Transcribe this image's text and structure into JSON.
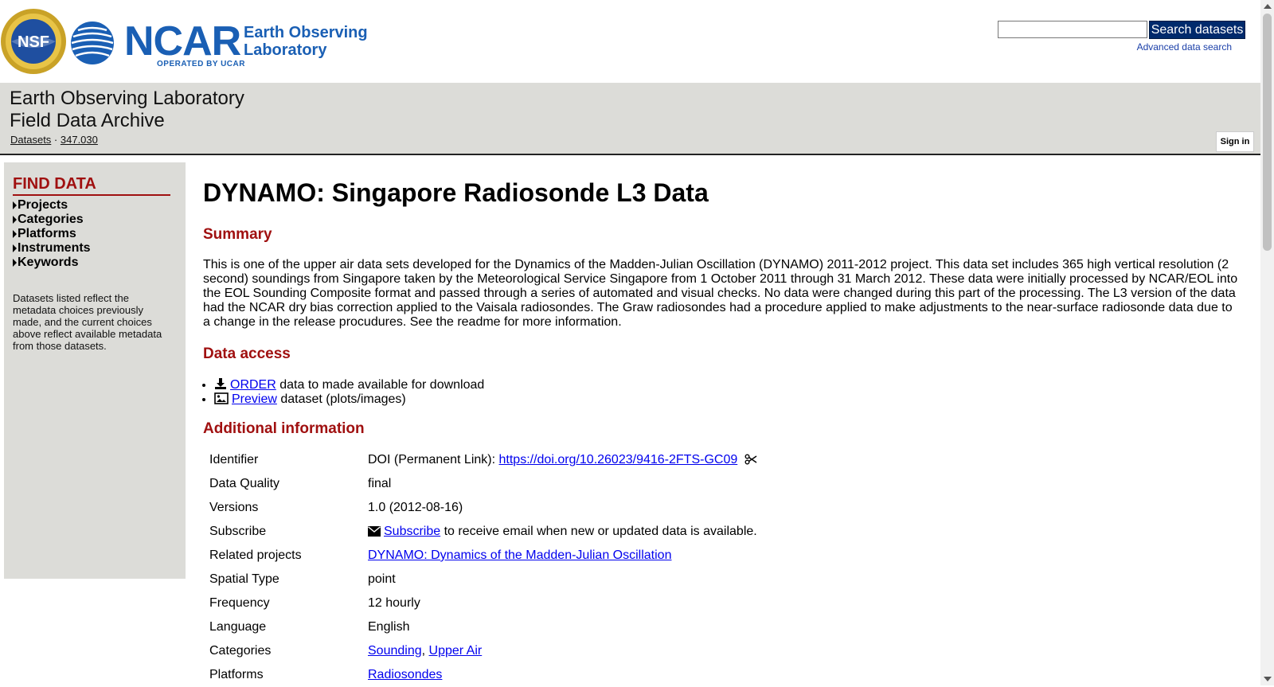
{
  "header": {
    "nsf_logo_text": "NSF",
    "ncar_word": "NCAR",
    "ncar_operated": "OPERATED BY UCAR",
    "eol_line1": "Earth Observing",
    "eol_line2": "Laboratory",
    "search_button": "Search datasets",
    "search_value": "",
    "advanced_search": "Advanced data search"
  },
  "band": {
    "title_line1": "Earth Observing Laboratory",
    "title_line2": "Field Data Archive",
    "breadcrumb_datasets": "Datasets",
    "breadcrumb_sep": " · ",
    "breadcrumb_id": "347.030",
    "signin": "Sign in"
  },
  "sidebar": {
    "title": "FIND DATA",
    "facets": [
      "Projects",
      "Categories",
      "Platforms",
      "Instruments",
      "Keywords"
    ],
    "note": "Datasets listed reflect the metadata choices previously made, and the current choices above reflect available metadata from those datasets."
  },
  "main": {
    "title": "DYNAMO: Singapore Radiosonde L3 Data",
    "summary_heading": "Summary",
    "summary": "This is one of the upper air data sets developed for the Dynamics of the Madden-Julian Oscillation (DYNAMO) 2011-2012 project. This data set includes 365 high vertical resolution (2 second) soundings from Singapore taken by the Meteorological Service Singapore from 1 October 2011 through 31 March 2012. These data were initially processed by NCAR/EOL into the EOL Sounding Composite format and passed through a series of automated and visual checks. No data were changed during this part of the processing. The L3 version of the data had the NCAR dry bias correction applied to the Vaisala radiosondes. The Graw radiosondes had a procedure applied to make adjustments to the near-surface radiosonde data due to a change in the release procudures. See the readme for more information.",
    "access_heading": "Data access",
    "access": {
      "order_link": "ORDER",
      "order_text": " data to made available for download",
      "preview_link": "Preview",
      "preview_text": " dataset (plots/images)"
    },
    "additional_heading": "Additional information",
    "info": {
      "identifier_label": "Identifier",
      "identifier_prefix": "DOI (Permanent Link): ",
      "identifier_link": "https://doi.org/10.26023/9416-2FTS-GC09",
      "quality_label": "Data Quality",
      "quality_value": "final",
      "versions_label": "Versions",
      "versions_value": "1.0 (2012-08-16)",
      "subscribe_label": "Subscribe",
      "subscribe_link": "Subscribe",
      "subscribe_text": " to receive email when new or updated data is available.",
      "projects_label": "Related projects",
      "projects_link": "DYNAMO: Dynamics of the Madden-Julian Oscillation",
      "spatial_label": "Spatial Type",
      "spatial_value": "point",
      "frequency_label": "Frequency",
      "frequency_value": "12 hourly",
      "language_label": "Language",
      "language_value": "English",
      "categories_label": "Categories",
      "category_1": "Sounding",
      "category_sep": ", ",
      "category_2": "Upper Air",
      "platforms_label": "Platforms",
      "platform_1": "Radiosondes"
    }
  },
  "colors": {
    "heading_red": "#a01010",
    "ncar_blue": "#1a5fb4",
    "band_gray": "#dcdcd8",
    "link_blue": "#0000ee",
    "search_button_bg": "#002a6c"
  }
}
